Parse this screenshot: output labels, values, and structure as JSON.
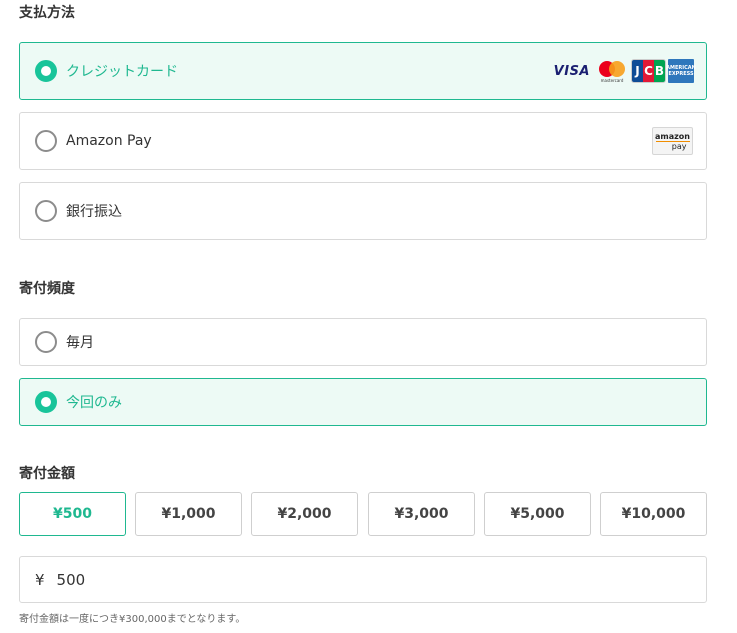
{
  "payment": {
    "title": "支払方法",
    "options": [
      {
        "label": "クレジットカード",
        "selected": true
      },
      {
        "label": "Amazon Pay",
        "selected": false
      },
      {
        "label": "銀行振込",
        "selected": false
      }
    ],
    "card_brands": {
      "visa": "VISA",
      "mastercard": "mastercard",
      "jcb": [
        "J",
        "C",
        "B"
      ],
      "amex": [
        "AMERICAN",
        "EXPRESS"
      ]
    },
    "amazon_logo": {
      "line1": "amazon",
      "line2": "pay"
    }
  },
  "frequency": {
    "title": "寄付頻度",
    "options": [
      {
        "label": "毎月",
        "selected": false
      },
      {
        "label": "今回のみ",
        "selected": true
      }
    ]
  },
  "amount": {
    "title": "寄付金額",
    "presets": [
      "¥500",
      "¥1,000",
      "¥2,000",
      "¥3,000",
      "¥5,000",
      "¥10,000"
    ],
    "selected_preset": "¥500",
    "currency_symbol": "¥",
    "value": "500",
    "note": "寄付金額は一度につき¥300,000までとなります。"
  },
  "colors": {
    "accent": "#1fb890",
    "selected_bg": "#edfaf5",
    "border": "#d9d9d9"
  }
}
